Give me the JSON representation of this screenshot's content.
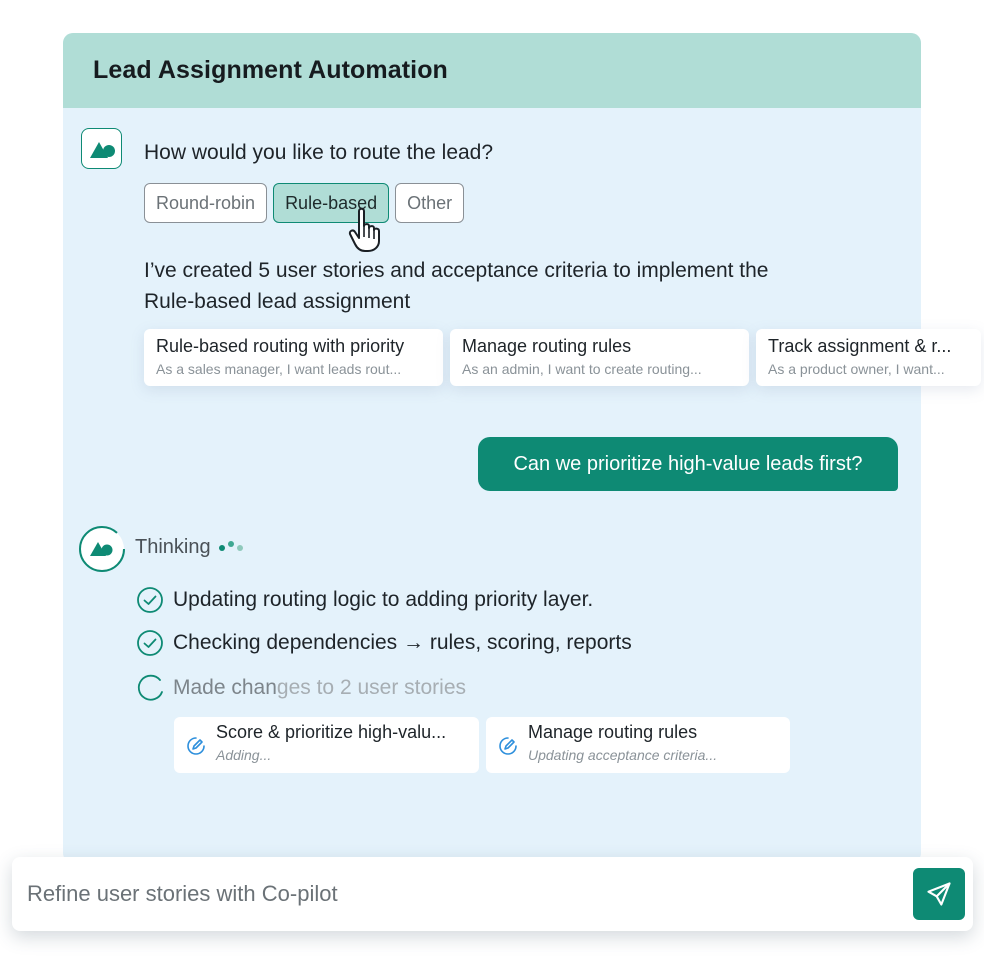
{
  "panel": {
    "title": "Lead Assignment Automation"
  },
  "question": "How would you like to route the lead?",
  "options": [
    {
      "label": "Round-robin",
      "selected": false
    },
    {
      "label": "Rule-based",
      "selected": true
    },
    {
      "label": "Other",
      "selected": false
    }
  ],
  "summary": "I’ve created 5 user stories and acceptance criteria to implement the Rule-based lead assignment",
  "stories": [
    {
      "title": "Rule-based routing with priority",
      "subtitle": "As a sales manager, I want leads rout..."
    },
    {
      "title": "Manage routing rules",
      "subtitle": "As an admin, I want to create routing..."
    },
    {
      "title": "Track assignment & r...",
      "subtitle": "As a product owner, I want..."
    }
  ],
  "user_message": "Can we prioritize high-value leads first?",
  "thinking": {
    "label": "Thinking"
  },
  "steps": [
    {
      "text": "Updating routing logic to adding priority layer.",
      "status": "done"
    },
    {
      "text": "Checking dependencies → rules, scoring, reports",
      "status": "done"
    },
    {
      "text_main": "Made chan",
      "text_faded": "ges to 2 user stories",
      "status": "in-progress"
    }
  ],
  "changes": [
    {
      "title": "Score & prioritize high-valu...",
      "status": "Adding..."
    },
    {
      "title": "Manage routing rules",
      "status": "Updating acceptance criteria..."
    }
  ],
  "input": {
    "placeholder": "Refine user stories with Co-pilot"
  },
  "colors": {
    "accent": "#0e8a74",
    "header": "#b0ddd6",
    "panel": "#e4f2fb"
  }
}
